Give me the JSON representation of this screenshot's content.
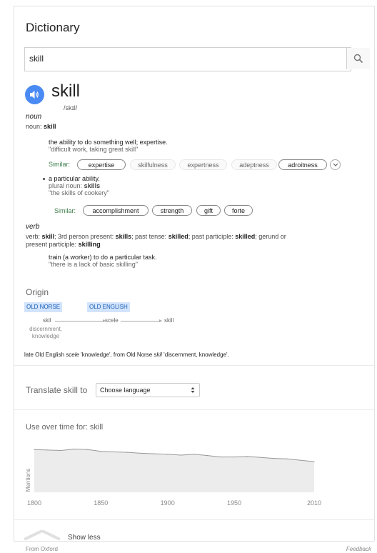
{
  "panel": {
    "title": "Dictionary"
  },
  "search": {
    "value": "skill",
    "button_icon": "search-icon"
  },
  "entry": {
    "word": "skill",
    "phonetic": "/skɪl/",
    "speaker_icon": "speaker-icon",
    "noun": {
      "pos": "noun",
      "head_label": "noun:",
      "head_word": "skill",
      "sense1": {
        "definition": "the ability to do something well; expertise.",
        "example": "\"difficult work, taking great skill\"",
        "similar_label": "Similar:",
        "similar": [
          "expertise",
          "skilfulness",
          "expertness",
          "adeptness",
          "adroitness"
        ]
      },
      "sense2": {
        "definition": "a particular ability.",
        "plural_label": "plural noun:",
        "plural_value": "skills",
        "example": "\"the skills of cookery\"",
        "similar_label": "Similar:",
        "similar": [
          "accomplishment",
          "strength",
          "gift",
          "forte"
        ]
      }
    },
    "verb": {
      "pos": "verb",
      "forms_line1": {
        "a": "verb:",
        "b": "skill",
        "c": "; 3rd person present:",
        "d": "skills",
        "e": "; past tense:",
        "f": "skilled",
        "g": "; past participle:",
        "h": "skilled",
        "i": "; gerund or"
      },
      "forms_line2": {
        "a": "present participle:",
        "b": "skilling"
      },
      "definition": "train (a worker) to do a particular task.",
      "example": "\"there is a lack of basic skilling\""
    }
  },
  "origin": {
    "title": "Origin",
    "lang1": "OLD NORSE",
    "lang2": "OLD ENGLISH",
    "w1": "skil",
    "w1_gloss_a": "discernment,",
    "w1_gloss_b": "knowledge",
    "w2": "scele",
    "w3": "skill",
    "text_a": "late Old English ",
    "text_b": "scele",
    "text_c": " 'knowledge', from Old Norse ",
    "text_d": "skil",
    "text_e": " 'discernment, knowledge'."
  },
  "translate": {
    "label": "Translate skill to",
    "select_value": "Choose language"
  },
  "usage": {
    "title": "Use over time for: skill",
    "ylabel": "Mentions",
    "x_ticks": [
      "1800",
      "1850",
      "1900",
      "1950",
      "2010"
    ]
  },
  "chart_data": {
    "type": "area",
    "title": "Use over time for: skill",
    "ylabel": "Mentions",
    "xlabel": "",
    "x": [
      1800,
      1810,
      1820,
      1830,
      1840,
      1850,
      1860,
      1870,
      1880,
      1890,
      1900,
      1910,
      1920,
      1930,
      1940,
      1950,
      1960,
      1970,
      1980,
      1990,
      2000,
      2010
    ],
    "values": [
      0.92,
      0.91,
      0.9,
      0.93,
      0.92,
      0.88,
      0.87,
      0.86,
      0.84,
      0.83,
      0.82,
      0.8,
      0.82,
      0.79,
      0.76,
      0.76,
      0.77,
      0.75,
      0.73,
      0.72,
      0.69,
      0.66
    ],
    "xlim": [
      1800,
      2010
    ],
    "ylim": [
      0,
      1
    ],
    "x_ticks": [
      "1800",
      "1850",
      "1900",
      "1950",
      "2010"
    ]
  },
  "show_less": {
    "label": "Show less"
  },
  "footer": {
    "source": "From Oxford",
    "feedback": "Feedback"
  }
}
